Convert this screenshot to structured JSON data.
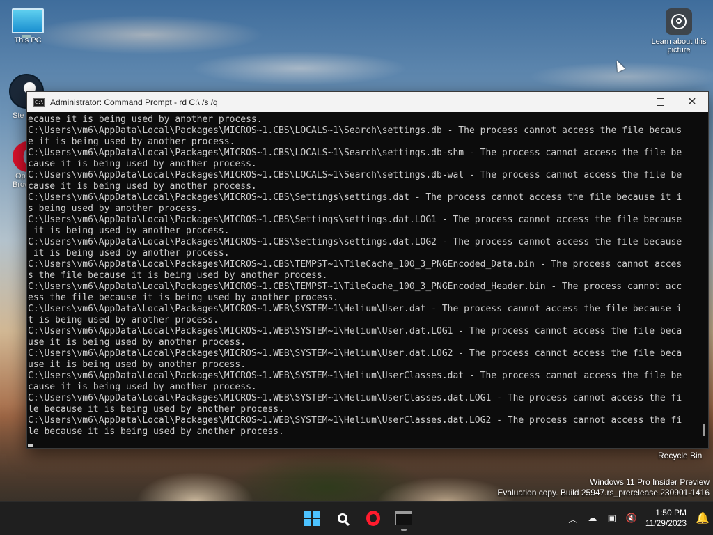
{
  "desktop": {
    "icons": {
      "this_pc": "This PC",
      "steam": "Ste",
      "opera_line1": "Op",
      "opera_line2": "Brow",
      "learn": "Learn about this picture",
      "recycle_bin": "Recycle Bin"
    },
    "watermark": {
      "line1": "Windows 11 Pro Insider Preview",
      "line2": "Evaluation copy. Build 25947.rs_prerelease.230901-1416"
    }
  },
  "window": {
    "title": "Administrator: Command Prompt - rd  C:\\ /s /q",
    "console_lines": [
      "ecause it is being used by another process.",
      "C:\\Users\\vm6\\AppData\\Local\\Packages\\MICROS~1.CBS\\LOCALS~1\\Search\\settings.db - The process cannot access the file becaus",
      "e it is being used by another process.",
      "C:\\Users\\vm6\\AppData\\Local\\Packages\\MICROS~1.CBS\\LOCALS~1\\Search\\settings.db-shm - The process cannot access the file be",
      "cause it is being used by another process.",
      "C:\\Users\\vm6\\AppData\\Local\\Packages\\MICROS~1.CBS\\LOCALS~1\\Search\\settings.db-wal - The process cannot access the file be",
      "cause it is being used by another process.",
      "C:\\Users\\vm6\\AppData\\Local\\Packages\\MICROS~1.CBS\\Settings\\settings.dat - The process cannot access the file because it i",
      "s being used by another process.",
      "C:\\Users\\vm6\\AppData\\Local\\Packages\\MICROS~1.CBS\\Settings\\settings.dat.LOG1 - The process cannot access the file because",
      " it is being used by another process.",
      "C:\\Users\\vm6\\AppData\\Local\\Packages\\MICROS~1.CBS\\Settings\\settings.dat.LOG2 - The process cannot access the file because",
      " it is being used by another process.",
      "C:\\Users\\vm6\\AppData\\Local\\Packages\\MICROS~1.CBS\\TEMPST~1\\TileCache_100_3_PNGEncoded_Data.bin - The process cannot acces",
      "s the file because it is being used by another process.",
      "C:\\Users\\vm6\\AppData\\Local\\Packages\\MICROS~1.CBS\\TEMPST~1\\TileCache_100_3_PNGEncoded_Header.bin - The process cannot acc",
      "ess the file because it is being used by another process.",
      "C:\\Users\\vm6\\AppData\\Local\\Packages\\MICROS~1.WEB\\SYSTEM~1\\Helium\\User.dat - The process cannot access the file because i",
      "t is being used by another process.",
      "C:\\Users\\vm6\\AppData\\Local\\Packages\\MICROS~1.WEB\\SYSTEM~1\\Helium\\User.dat.LOG1 - The process cannot access the file beca",
      "use it is being used by another process.",
      "C:\\Users\\vm6\\AppData\\Local\\Packages\\MICROS~1.WEB\\SYSTEM~1\\Helium\\User.dat.LOG2 - The process cannot access the file beca",
      "use it is being used by another process.",
      "C:\\Users\\vm6\\AppData\\Local\\Packages\\MICROS~1.WEB\\SYSTEM~1\\Helium\\UserClasses.dat - The process cannot access the file be",
      "cause it is being used by another process.",
      "C:\\Users\\vm6\\AppData\\Local\\Packages\\MICROS~1.WEB\\SYSTEM~1\\Helium\\UserClasses.dat.LOG1 - The process cannot access the fi",
      "le because it is being used by another process.",
      "C:\\Users\\vm6\\AppData\\Local\\Packages\\MICROS~1.WEB\\SYSTEM~1\\Helium\\UserClasses.dat.LOG2 - The process cannot access the fi",
      "le because it is being used by another process."
    ]
  },
  "taskbar": {
    "apps": [
      "start-icon",
      "search-icon",
      "opera-icon",
      "command-prompt-icon"
    ],
    "accent": "#4cc2ff",
    "clock": {
      "time": "1:50 PM",
      "date": "11/29/2023"
    }
  }
}
